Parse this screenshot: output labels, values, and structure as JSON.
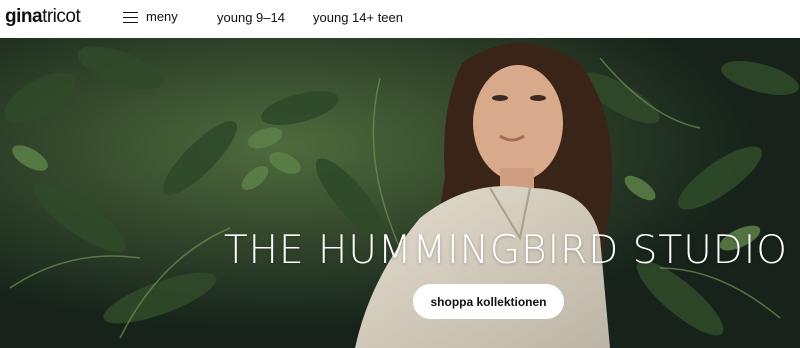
{
  "header": {
    "logo_bold": "gina",
    "logo_light": "tricot",
    "menu_label": "meny",
    "nav": [
      {
        "label": "young 9–14"
      },
      {
        "label": "young 14+ teen"
      }
    ]
  },
  "hero": {
    "title": "THE HUMMINGBIRD STUDIO",
    "cta_label": "shoppa kollektionen"
  },
  "colors": {
    "foliage_dark": "#1c2a1d",
    "foliage_mid": "#3d5a34",
    "foliage_light": "#8fb36a",
    "jacket": "#d8d2c4",
    "hair": "#3a2418",
    "skin": "#d9a98c"
  }
}
